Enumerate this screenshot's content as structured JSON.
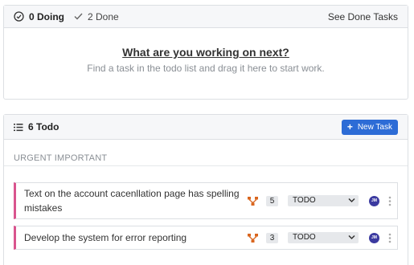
{
  "doing": {
    "doing_count": "0 Doing",
    "done_count": "2 Done",
    "see_done": "See Done Tasks",
    "empty_title": "What are you working on next?",
    "empty_sub": "Find a task in the todo list and drag it here to start work."
  },
  "todo": {
    "title": "6 Todo",
    "new_task_label": "New Task",
    "group_label": "URGENT IMPORTANT",
    "tasks": [
      {
        "name": "Text on the account cacenllation page has spelling mistakes",
        "estimate": "5",
        "status": "TODO",
        "assignee": "JM"
      },
      {
        "name": "Develop the system for error reporting",
        "estimate": "3",
        "status": "TODO",
        "assignee": "JM"
      }
    ]
  },
  "colors": {
    "accent": "#2d6cd6",
    "priority_bar": "#d9548e",
    "dependency_icon": "#d9661f",
    "avatar": "#3b3aa0"
  }
}
